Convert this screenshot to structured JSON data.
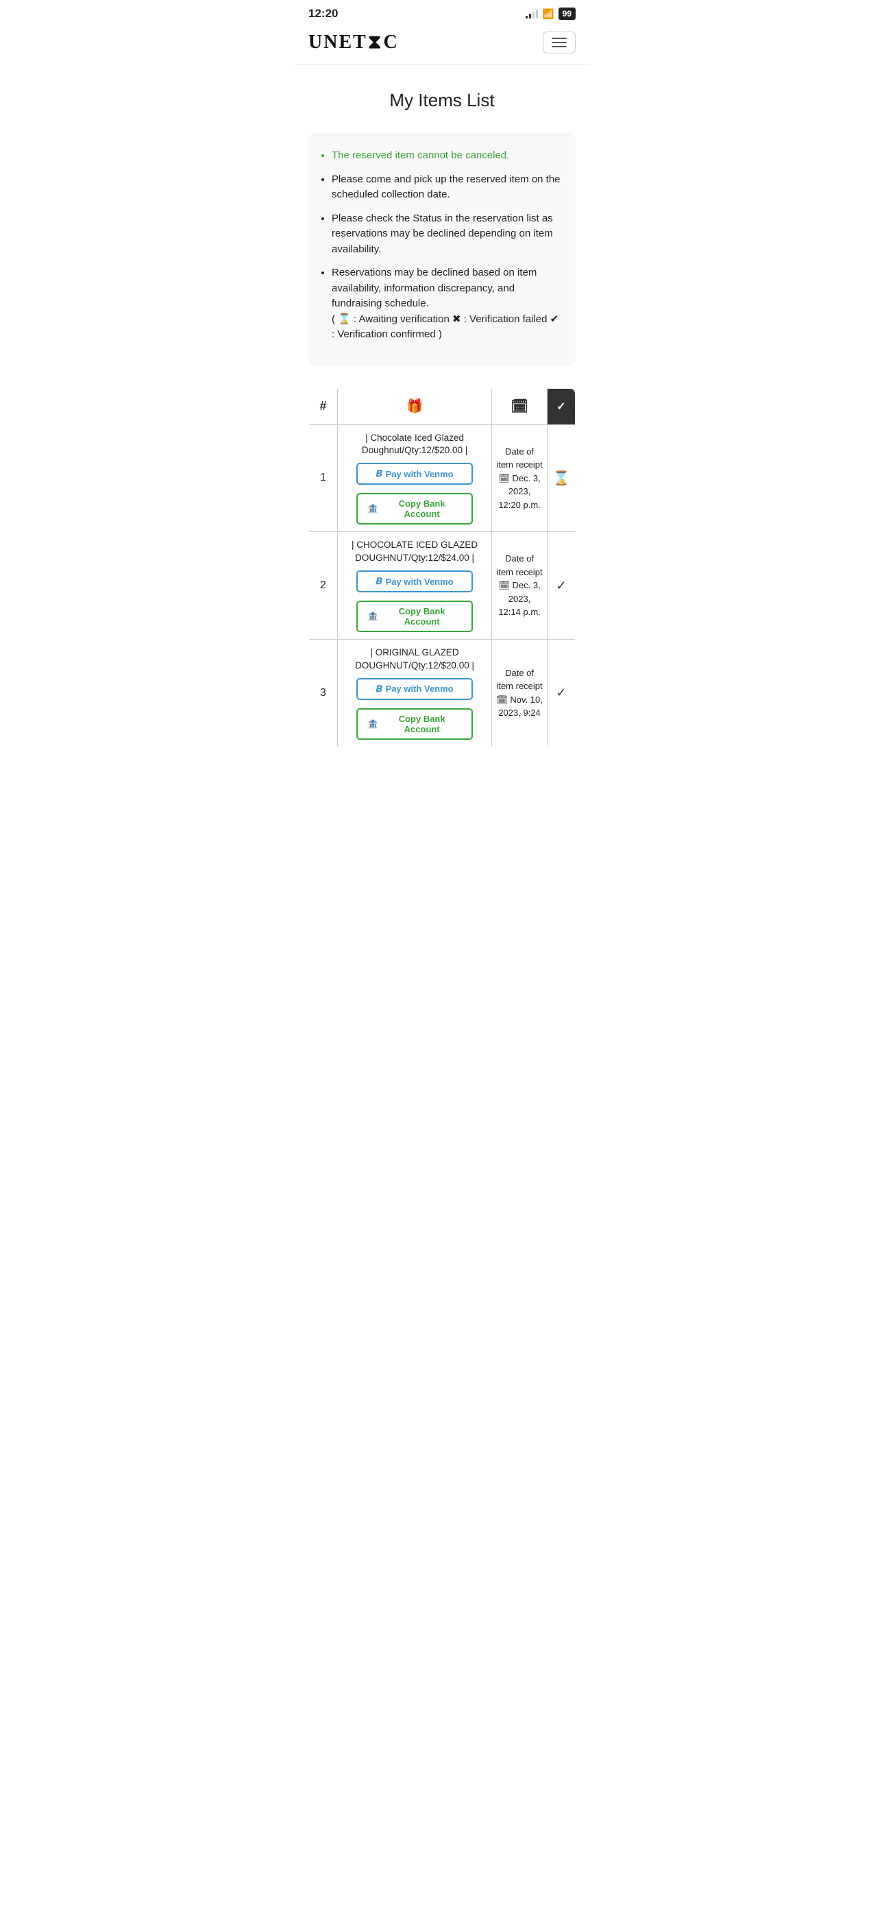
{
  "statusBar": {
    "time": "12:20",
    "battery": "99"
  },
  "header": {
    "logo": "UNETIC",
    "menuLabel": "Menu"
  },
  "page": {
    "title": "My Items List"
  },
  "infoBox": {
    "bullets": [
      {
        "text": "The reserved item cannot be canceled.",
        "green": true
      },
      {
        "text": "Please come and pick up the reserved item on the scheduled collection date.",
        "green": false
      },
      {
        "text": "Please check the Status in the reservation list as reservations may be declined depending on item availability.",
        "green": false
      },
      {
        "text": "Reservations may be declined based on item availability, information discrepancy, and fundraising schedule.",
        "green": false
      }
    ],
    "legend": "( ⌛ : Awaiting verification  ✖ : Verification failed  ✔ : Verification confirmed )"
  },
  "table": {
    "headers": {
      "num": "#",
      "item": "🎁",
      "date": "📅",
      "status": "✔"
    },
    "rows": [
      {
        "num": "1",
        "itemName": "| Chocolate Iced Glazed Doughnut/Qty:12/$20.00 |",
        "venmoLabel": "Pay with Venmo",
        "bankLabel": "Copy Bank Account",
        "dateLabel": "Date of item receipt",
        "date": "Dec. 3, 2023, 12:20 p.m.",
        "status": "hourglass"
      },
      {
        "num": "2",
        "itemName": "| CHOCOLATE ICED GLAZED DOUGHNUT/Qty:12/$24.00 |",
        "venmoLabel": "Pay with Venmo",
        "bankLabel": "Copy Bank Account",
        "dateLabel": "Date of item receipt",
        "date": "Dec. 3, 2023, 12:14 p.m.",
        "status": "check"
      },
      {
        "num": "3",
        "itemName": "| ORIGINAL GLAZED DOUGHNUT/Qty:12/$20.00 |",
        "venmoLabel": "Pay with Venmo",
        "bankLabel": "Copy Bank Account",
        "dateLabel": "Date of item receipt",
        "date": "Nov. 10, 2023, 9:24",
        "status": "check"
      }
    ]
  }
}
